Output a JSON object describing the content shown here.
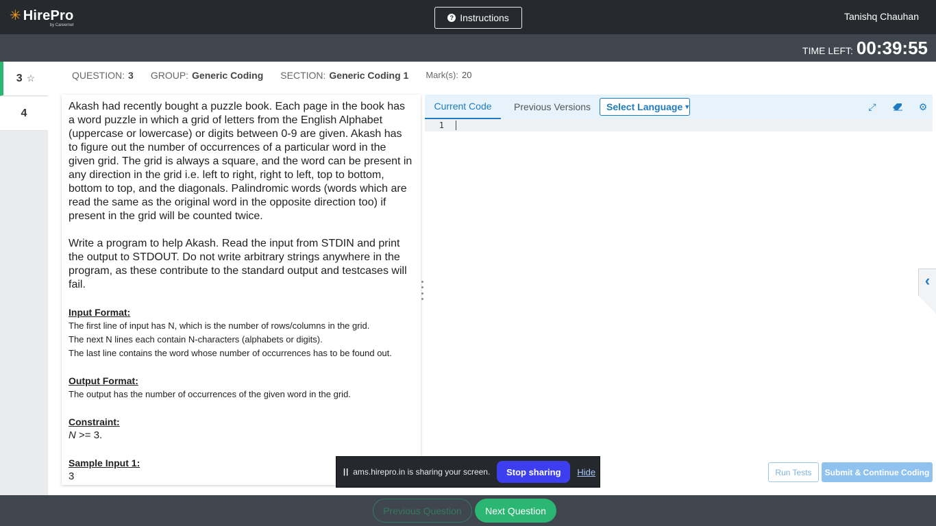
{
  "header": {
    "brand": "HirePro",
    "brand_sub": "by Careernet",
    "instructions_label": "Instructions",
    "username": "Tanishq Chauhan"
  },
  "timer": {
    "label": "TIME LEFT:",
    "value": "00:39:55"
  },
  "question_nav": {
    "items": [
      {
        "num": "3",
        "active": true
      },
      {
        "num": "4",
        "active": false
      }
    ]
  },
  "meta": {
    "question_key": "QUESTION:",
    "question_val": "3",
    "group_key": "GROUP:",
    "group_val": "Generic Coding",
    "section_key": "SECTION:",
    "section_val": "Generic Coding 1",
    "marks_key": "Mark(s):",
    "marks_val": "20"
  },
  "question": {
    "para1": "Akash had recently bought a puzzle book. Each page in the book has a word puzzle in which a grid of letters from the English Alphabet (uppercase or lowercase) or digits between 0-9 are given. Akash has to figure out the number of occurrences of a particular word in the given grid. The grid is always a square, and the word can be present in any direction in the grid i.e. left to right, right to left, top to bottom, bottom to top, and the diagonals. Palindromic words (words which are read the same as the original word in the opposite direction too) if present in the grid will be counted twice.",
    "para2": "Write a program to help Akash. Read the input from STDIN and print the output to STDOUT. Do not write arbitrary strings anywhere in the program, as these contribute to the standard output and testcases will fail.",
    "input_heading": "Input Format:",
    "input_lines": [
      "The first line of input has N, which is the number of rows/columns in the grid.",
      "The next N lines each contain N-characters (alphabets or digits).",
      "The last line contains the word whose number of occurrences has to be found out."
    ],
    "output_heading": "Output Format:",
    "output_line": "The output has the number of occurrences of the given word in the grid.",
    "constraint_heading": "Constraint:",
    "constraint_var": "N",
    "constraint_rest": " >= 3.",
    "sample_heading": "Sample Input 1:",
    "sample_first": "3"
  },
  "editor": {
    "tab_current": "Current Code",
    "tab_previous": "Previous Versions",
    "language_placeholder": "Select Language",
    "line_number": "1",
    "run_tests": "Run Tests",
    "submit": "Submit & Continue Coding"
  },
  "share_banner": {
    "message": "ams.hirepro.in is sharing your screen.",
    "stop": "Stop sharing",
    "hide": "Hide"
  },
  "footer": {
    "prev": "Previous Question",
    "next": "Next Question"
  },
  "colors": {
    "accent_green": "#2bb673",
    "accent_blue": "#1f7bc1",
    "header_dark": "#26292d",
    "bar_gray": "#3f464e"
  }
}
